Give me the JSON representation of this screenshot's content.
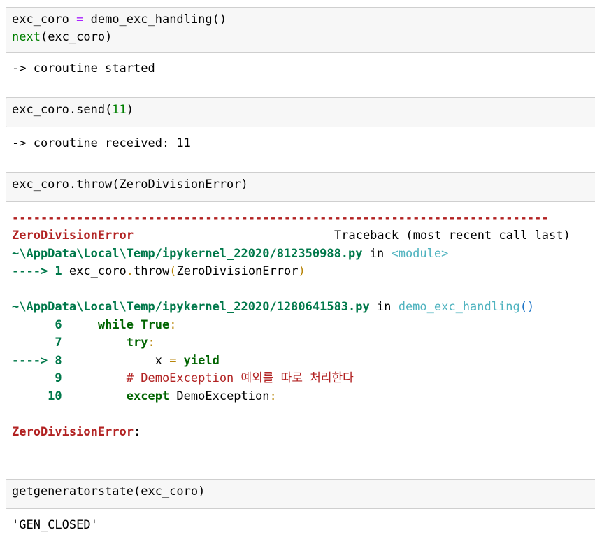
{
  "cells": {
    "cell1": {
      "line1": {
        "a": "exc_coro ",
        "op": "=",
        "b": " demo_exc_handling()"
      },
      "line2": {
        "kw": "next",
        "rest": "(exc_coro)"
      },
      "output": "-> coroutine started"
    },
    "cell2": {
      "code_a": "exc_coro.send(",
      "code_num": "11",
      "code_b": ")",
      "output": "-> coroutine received: 11"
    },
    "cell3": {
      "code": "exc_coro.throw(ZeroDivisionError)",
      "traceback": {
        "dashes": "---------------------------------------------------------------------------",
        "error_name": "ZeroDivisionError",
        "traceback_header": "Traceback (most recent call last)",
        "frame1_path": "~\\AppData\\Local\\Temp/ipykernel_22020/812350988.py",
        "frame1_in": " in ",
        "frame1_func": "<module>",
        "frame1_arrow": "----> 1 ",
        "frame1_code_a": "exc_coro",
        "frame1_code_dot": ".",
        "frame1_code_b": "throw",
        "frame1_code_paren_open": "(",
        "frame1_code_c": "ZeroDivisionError",
        "frame1_code_paren_close": ")",
        "frame2_path": "~\\AppData\\Local\\Temp/ipykernel_22020/1280641583.py",
        "frame2_in": " in ",
        "frame2_func": "demo_exc_handling",
        "frame2_parens": "()",
        "l6_num": "      6 ",
        "l6_kw": "    while True",
        "l6_colon": ":",
        "l7_num": "      7 ",
        "l7_kw": "        try",
        "l7_colon": ":",
        "l8_arrow": "----> 8 ",
        "l8_a": "            x ",
        "l8_eq": "=",
        "l8_kw": " yield",
        "l9_num": "      9 ",
        "l9_comment": "        # DemoException 예외를 따로 처리한다",
        "l10_num": "     10 ",
        "l10_kw": "        except",
        "l10_rest": " DemoException",
        "l10_colon": ":",
        "final_error": "ZeroDivisionError",
        "final_colon": ":"
      }
    },
    "cell4": {
      "code": "getgeneratorstate(exc_coro)",
      "output": "'GEN_CLOSED'"
    }
  }
}
